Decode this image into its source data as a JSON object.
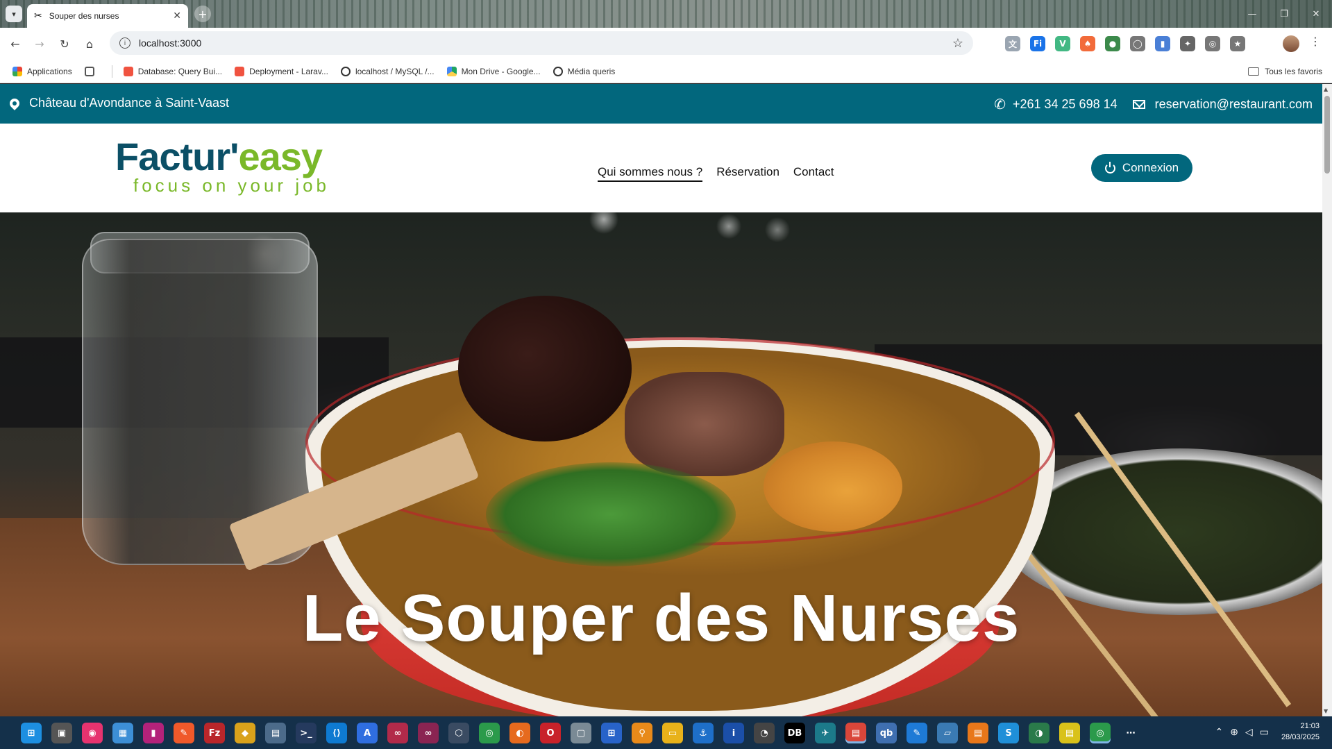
{
  "browser": {
    "tab_title": "Souper des nurses",
    "tab_icon": "close-scissors-icon",
    "url": "localhost:3000",
    "bookmarks": [
      {
        "label": "Applications",
        "icon": "apps-grid-icon",
        "color": "#e8453c"
      },
      {
        "label": "Database: Query Bui...",
        "icon": "laravel-icon",
        "color": "#f05340"
      },
      {
        "label": "Deployment - Larav...",
        "icon": "laravel-icon",
        "color": "#f05340"
      },
      {
        "label": "localhost / MySQL /...",
        "icon": "globe-icon",
        "color": "#333333"
      },
      {
        "label": "Mon Drive - Google...",
        "icon": "google-drive-icon",
        "color": "#1fa463"
      },
      {
        "label": "Média queris",
        "icon": "globe-icon",
        "color": "#333333"
      }
    ],
    "favorites_label": "Tous les favoris"
  },
  "site": {
    "topbar": {
      "location": "Château d'Avondance à Saint-Vaast",
      "phone": "+261 34 25 698 14",
      "email": "reservation@restaurant.com"
    },
    "logo": {
      "part1": "Factur'",
      "part2": "easy",
      "tagline": "focus on your job"
    },
    "nav": [
      {
        "label": "Qui sommes nous ?",
        "active": true
      },
      {
        "label": "Réservation",
        "active": false
      },
      {
        "label": "Contact",
        "active": false
      }
    ],
    "login_label": "Connexion",
    "hero_title": "Le Souper des Nurses",
    "colors": {
      "primary": "#02677d",
      "logo_dark": "#0b4f66",
      "logo_green": "#7ab829"
    }
  },
  "taskbar": {
    "time": "21:03",
    "date": "28/03/2025"
  }
}
